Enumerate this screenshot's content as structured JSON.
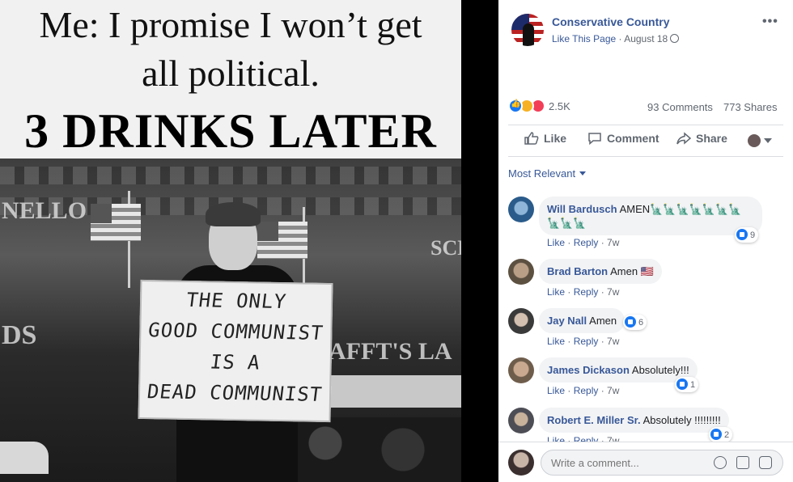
{
  "meme": {
    "caption_line1": "Me: I promise I won’t get",
    "caption_line2": "all political.",
    "caption_line3": "3 DRINKS LATER",
    "sign_lines": [
      "THE ONLY",
      "GOOD COMMUNIST",
      "IS A",
      "DEAD COMMUNIST"
    ],
    "store_sign_left": "NELLO",
    "store_sign_right": "SCH",
    "store_sign_bottom": "AFFT'S LA",
    "store_sign_ds": "DS"
  },
  "post": {
    "page_name": "Conservative Country",
    "like_page": "Like This Page",
    "separator": " · ",
    "date": "August 18",
    "more": "•••",
    "reaction_count": "2.5K",
    "comments_count": "93 Comments",
    "shares_count": "773 Shares",
    "actions": {
      "like": "Like",
      "comment": "Comment",
      "share": "Share"
    },
    "sort_label": "Most Relevant"
  },
  "comments": [
    {
      "name": "Will Bardusch",
      "text": "AMEN🗽🗽🗽🗽🗽🗽🗽🗽🗽🗽",
      "like": "Like",
      "reply": "Reply",
      "time": "7w",
      "reactions": "9"
    },
    {
      "name": "Brad Barton",
      "text": "Amen 🇺🇸",
      "like": "Like",
      "reply": "Reply",
      "time": "7w",
      "reactions": ""
    },
    {
      "name": "Jay Nall",
      "text": "Amen",
      "like": "Like",
      "reply": "Reply",
      "time": "7w",
      "reactions": "6"
    },
    {
      "name": "James Dickason",
      "text": "Absolutely!!!",
      "like": "Like",
      "reply": "Reply",
      "time": "7w",
      "reactions": "1"
    },
    {
      "name": "Robert E. Miller Sr.",
      "text": "Absolutely !!!!!!!!!",
      "like": "Like",
      "reply": "Reply",
      "time": "7w",
      "reactions": "2"
    }
  ],
  "composer": {
    "placeholder": "Write a comment..."
  },
  "colors": {
    "link": "#385898",
    "like_blue": "#1877f2",
    "haha": "#f7b125",
    "love": "#f33e58",
    "bubble": "#f2f3f5"
  },
  "icons": [
    "globe-icon",
    "more-icon",
    "like-icon",
    "comment-icon",
    "share-icon",
    "caret-icon",
    "emoji-icon",
    "gif-icon",
    "sticker-icon"
  ]
}
